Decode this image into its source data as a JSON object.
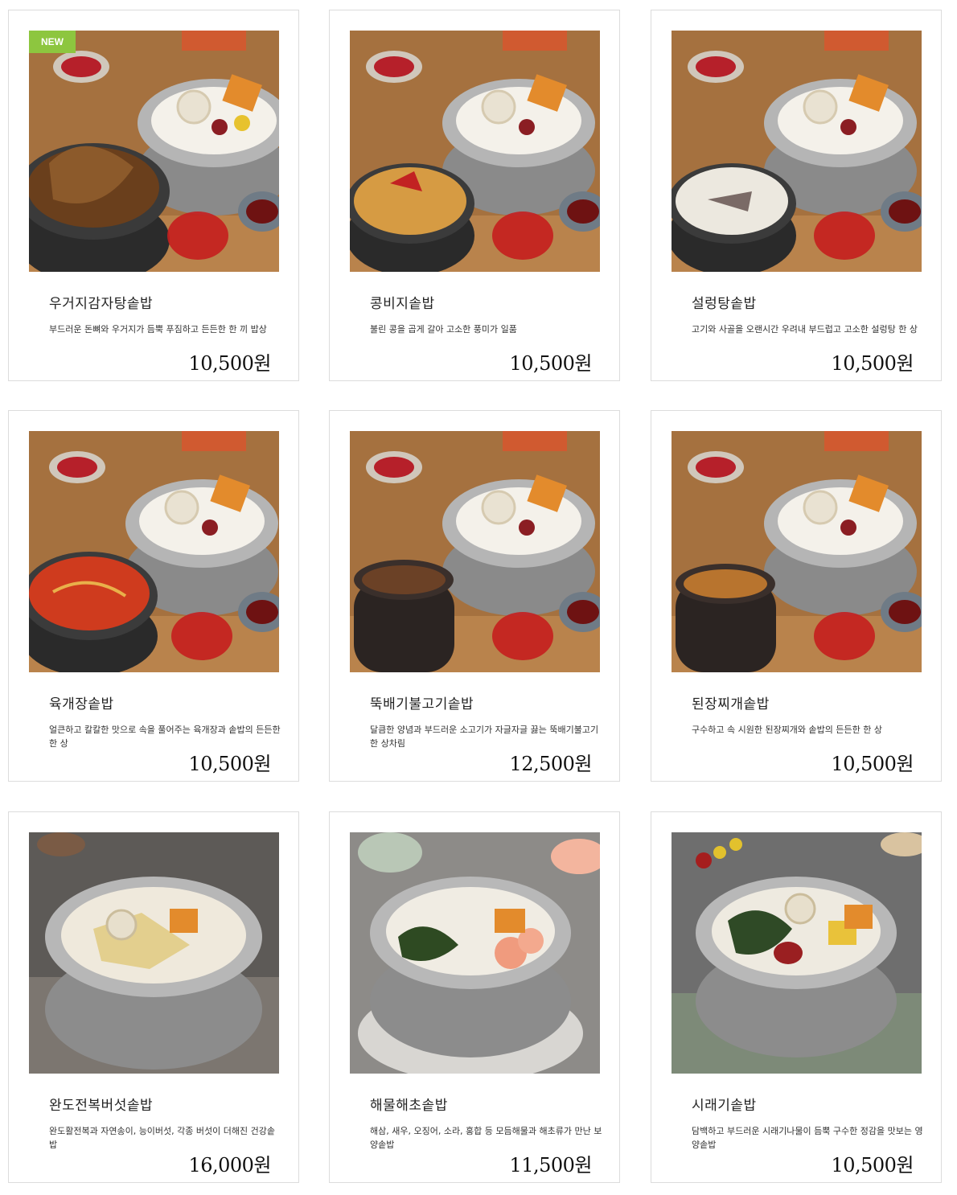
{
  "products": [
    {
      "name": "우거지감자탕솥밥",
      "desc": "부드러운 돈뼈와 우거지가 듬뿍 푸짐하고 든든한 한 끼 밥상",
      "price": "10,500원",
      "badge": "NEW"
    },
    {
      "name": "콩비지솥밥",
      "desc": "불린 콩을 곱게 갈아 고소한 풍미가 일품",
      "price": "10,500원"
    },
    {
      "name": "설렁탕솥밥",
      "desc": "고기와 사골을 오랜시간 우려내 부드럽고 고소한 설렁탕 한 상",
      "price": "10,500원"
    },
    {
      "name": "육개장솥밥",
      "desc": "얼큰하고 칼칼한 맛으로 속을 풀어주는 육개장과 솥밥의 든든한 한 상",
      "price": "10,500원"
    },
    {
      "name": "뚝배기불고기솥밥",
      "desc": "달큼한 양념과 부드러운 소고기가 자글자글 끓는 뚝배기불고기 한 상차림",
      "price": "12,500원"
    },
    {
      "name": "된장찌개솥밥",
      "desc": "구수하고 속 시원한 된장찌개와 솥밥의 든든한 한 상",
      "price": "10,500원"
    },
    {
      "name": "완도전복버섯솥밥",
      "desc": "완도활전복과 자연송이, 능이버섯, 각종 버섯이 더해진 건강솥밥",
      "price": "16,000원"
    },
    {
      "name": "해물해초솥밥",
      "desc": "해삼, 새우, 오징어, 소라, 홍합 등 모듬해물과 해초류가 만난 보양솥밥",
      "price": "11,500원"
    },
    {
      "name": "시래기솥밥",
      "desc": "담백하고 부드러운 시래기나물이 듬뿍 구수한 정감을 맛보는 영양솥밥",
      "price": "10,500원"
    }
  ],
  "colors": {
    "badge": "#8dc63f",
    "card_border": "#dcdcdc"
  }
}
